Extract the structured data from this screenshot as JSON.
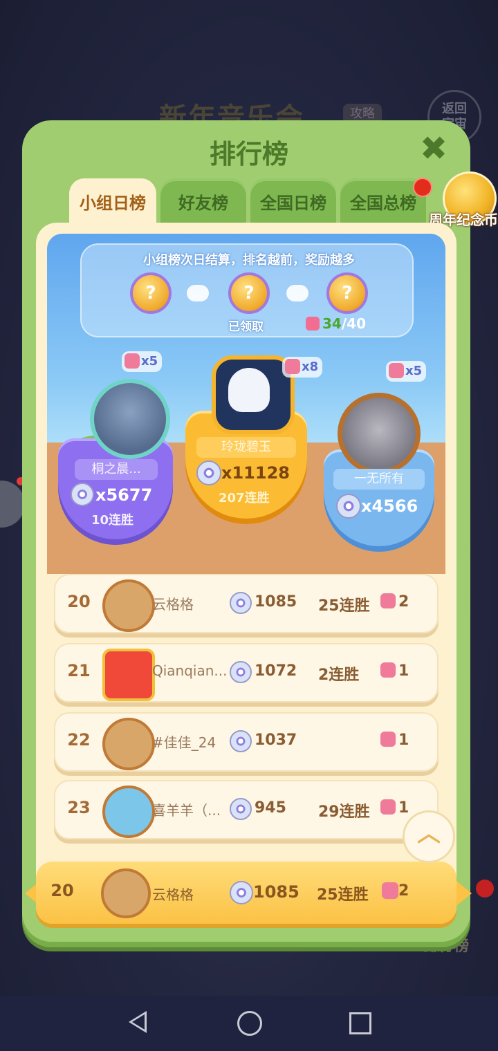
{
  "background": {
    "title": "新年音乐会",
    "guide_tag": "攻略",
    "return_button": "返回\n宇宙",
    "bottom_label": "排行榜"
  },
  "panel": {
    "title": "排行榜",
    "close_icon": "close-x-icon",
    "tabs": [
      {
        "label": "小组日榜",
        "active": true
      },
      {
        "label": "好友榜",
        "active": false
      },
      {
        "label": "全国日榜",
        "active": false
      },
      {
        "label": "全国总榜",
        "active": false
      }
    ],
    "side_badge_label": "周年纪念币"
  },
  "rewards": {
    "info": "小组榜次日结算，排名越前，奖励越多",
    "claimed_label": "已领取",
    "progress_current": "34",
    "progress_total": "/40",
    "reward_mark": "?"
  },
  "podium": [
    {
      "place": 2,
      "name": "桐之晨...",
      "score": "x5677",
      "streak": "10连胜",
      "pieces": "x5"
    },
    {
      "place": 1,
      "name": "玲珑碧玉",
      "score": "x11128",
      "streak": "207连胜",
      "pieces": "x8"
    },
    {
      "place": 3,
      "name": "一无所有",
      "score": "x4566",
      "streak": "",
      "pieces": "x5"
    }
  ],
  "rows": [
    {
      "rank": "20",
      "name": "云格格",
      "score": "1085",
      "streak": "25连胜",
      "pieces": "2",
      "avatar": "deer"
    },
    {
      "rank": "21",
      "name": "Qianqian...",
      "score": "1072",
      "streak": "2连胜",
      "pieces": "1",
      "avatar": "red"
    },
    {
      "rank": "22",
      "name": "#佳佳_24",
      "score": "1037",
      "streak": "",
      "pieces": "1",
      "avatar": "deer"
    },
    {
      "rank": "23",
      "name": "喜羊羊（...",
      "score": "945",
      "streak": "29连胜",
      "pieces": "1",
      "avatar": "teal"
    }
  ],
  "me": {
    "rank": "20",
    "name": "云格格",
    "score": "1085",
    "streak": "25连胜",
    "pieces": "2"
  },
  "colors": {
    "panel_green": "#9fcd6f",
    "gold": "#fbbc34",
    "purple": "#8d6ff0",
    "blue": "#79b7ee",
    "cream": "#fdf1d0"
  }
}
